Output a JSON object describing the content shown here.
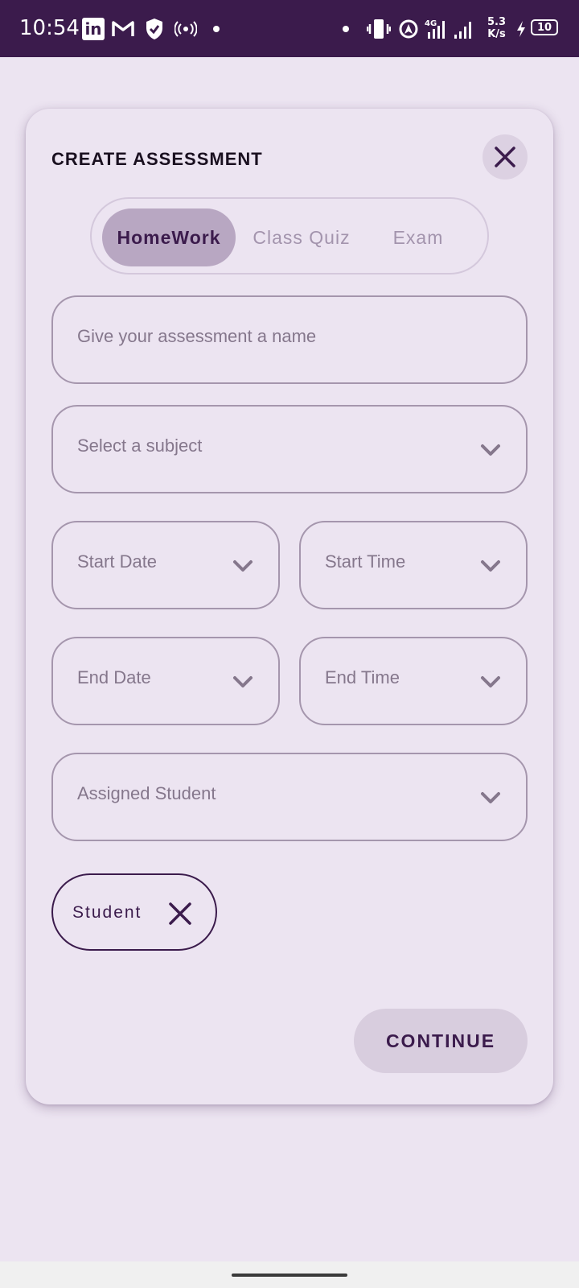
{
  "status_bar": {
    "time": "10:54",
    "linkedin_icon": "in",
    "gmail_icon": "gmail-icon",
    "network_speed_value": "5.3",
    "network_speed_unit": "K/s",
    "network_type": "4G",
    "battery_level": "10",
    "colors": {
      "background": "#3b1b4c"
    }
  },
  "dialog": {
    "title": "CREATE ASSESSMENT",
    "close_icon": "close-icon",
    "tabs": [
      {
        "label": "HomeWork",
        "active": true
      },
      {
        "label": "Class Quiz",
        "active": false
      },
      {
        "label": "Exam",
        "active": false
      }
    ],
    "fields": {
      "name": {
        "placeholder": "Give your assessment a name"
      },
      "subject": {
        "placeholder": "Select a subject"
      },
      "start_date": {
        "placeholder": "Start Date"
      },
      "start_time": {
        "placeholder": "Start Time"
      },
      "end_date": {
        "placeholder": "End Date"
      },
      "end_time": {
        "placeholder": "End Time"
      },
      "assigned_student": {
        "placeholder": "Assigned Student"
      }
    },
    "chip": {
      "label": "Student",
      "remove_icon": "close-icon"
    },
    "continue_label": "CONTINUE",
    "colors": {
      "accent": "#3b1b4c",
      "active_tab": "#b8a7c2",
      "surface": "#ece4f1"
    }
  }
}
